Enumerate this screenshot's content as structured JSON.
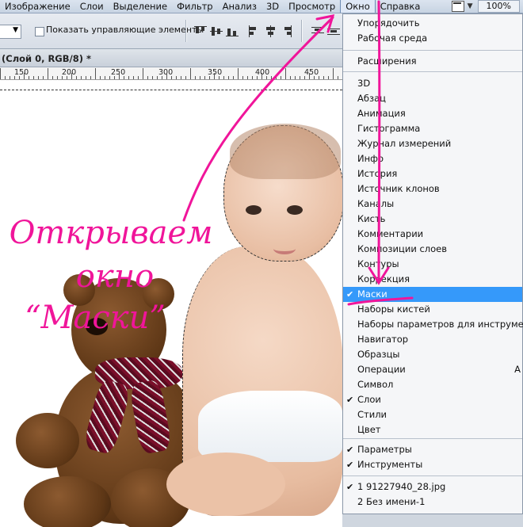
{
  "menubar": {
    "items": [
      "Изображение",
      "Слои",
      "Выделение",
      "Фильтр",
      "Анализ",
      "3D",
      "Просмотр",
      "Окно",
      "Справка"
    ],
    "zoom": "100%"
  },
  "options": {
    "show_controls_label": "Показать управляющие элементы"
  },
  "document": {
    "tab_title": "(Слой 0, RGB/8) *",
    "ruler_labels": [
      "150",
      "200",
      "250",
      "300",
      "350",
      "400",
      "450"
    ]
  },
  "annotation": {
    "line1": "Открываем",
    "line2": "окно",
    "line3": "“Маски”",
    "color": "#f0159a"
  },
  "window_menu": {
    "group1": [
      {
        "label": "Упорядочить",
        "checked": false
      },
      {
        "label": "Рабочая среда",
        "checked": false
      }
    ],
    "group2": [
      {
        "label": "Расширения",
        "checked": false
      }
    ],
    "group3": [
      {
        "label": "3D",
        "checked": false
      },
      {
        "label": "Абзац",
        "checked": false
      },
      {
        "label": "Анимация",
        "checked": false
      },
      {
        "label": "Гистограмма",
        "checked": false
      },
      {
        "label": "Журнал измерений",
        "checked": false
      },
      {
        "label": "Инфо",
        "checked": false
      },
      {
        "label": "История",
        "checked": false
      },
      {
        "label": "Источник клонов",
        "checked": false
      },
      {
        "label": "Каналы",
        "checked": false
      },
      {
        "label": "Кисть",
        "checked": false
      },
      {
        "label": "Комментарии",
        "checked": false
      },
      {
        "label": "Композиции слоев",
        "checked": false
      },
      {
        "label": "Контуры",
        "checked": false
      },
      {
        "label": "Коррекция",
        "checked": false
      },
      {
        "label": "Маски",
        "checked": true,
        "highlighted": true
      },
      {
        "label": "Наборы кистей",
        "checked": false
      },
      {
        "label": "Наборы параметров для инструмент",
        "checked": false
      },
      {
        "label": "Навигатор",
        "checked": false
      },
      {
        "label": "Образцы",
        "checked": false
      },
      {
        "label": "Операции",
        "checked": false,
        "trail": "A"
      },
      {
        "label": "Символ",
        "checked": false
      },
      {
        "label": "Слои",
        "checked": true
      },
      {
        "label": "Стили",
        "checked": false
      },
      {
        "label": "Цвет",
        "checked": false
      }
    ],
    "group4": [
      {
        "label": "Параметры",
        "checked": true
      },
      {
        "label": "Инструменты",
        "checked": true
      }
    ],
    "group5": [
      {
        "label": "1 91227940_28.jpg",
        "checked": true
      },
      {
        "label": "2 Без имени-1",
        "checked": false
      }
    ]
  }
}
